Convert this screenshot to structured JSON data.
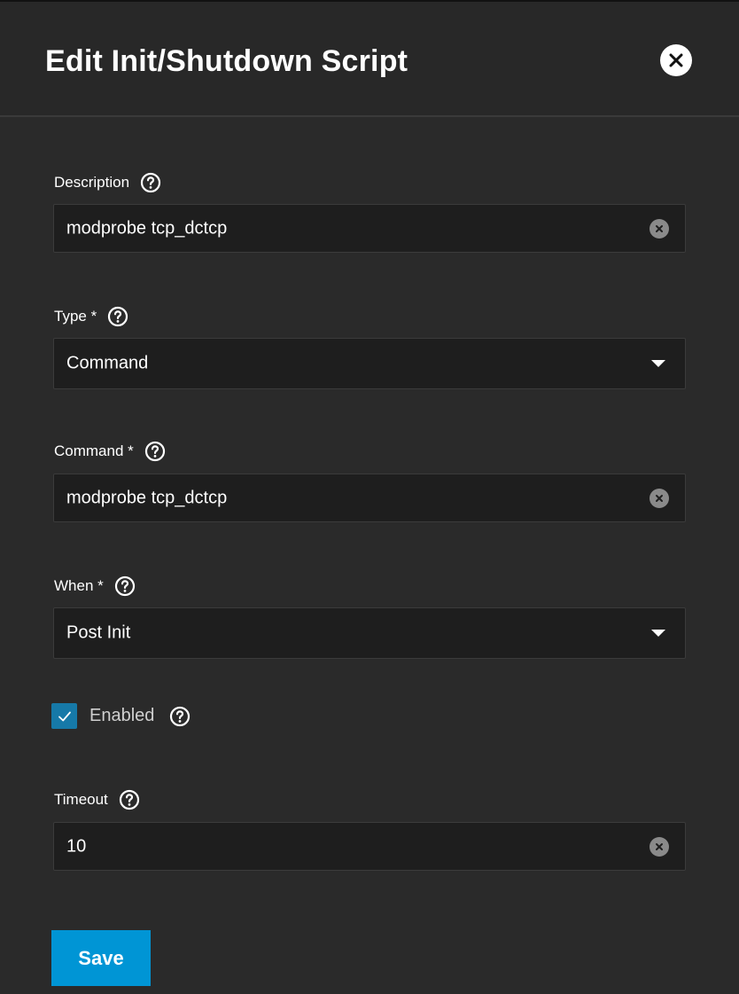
{
  "dialog": {
    "title": "Edit Init/Shutdown Script",
    "close_icon": "close-icon"
  },
  "form": {
    "description": {
      "label": "Description",
      "value": "modprobe tcp_dctcp"
    },
    "type": {
      "label": "Type *",
      "selected": "Command"
    },
    "command": {
      "label": "Command *",
      "value": "modprobe tcp_dctcp"
    },
    "when": {
      "label": "When *",
      "selected": "Post Init"
    },
    "enabled": {
      "label": "Enabled",
      "checked": true
    },
    "timeout": {
      "label": "Timeout",
      "value": "10"
    }
  },
  "actions": {
    "save_label": "Save"
  },
  "colors": {
    "background": "#2a2a2a",
    "field_background": "#1e1e1e",
    "accent": "#0095d5",
    "checkbox": "#1679a8"
  }
}
